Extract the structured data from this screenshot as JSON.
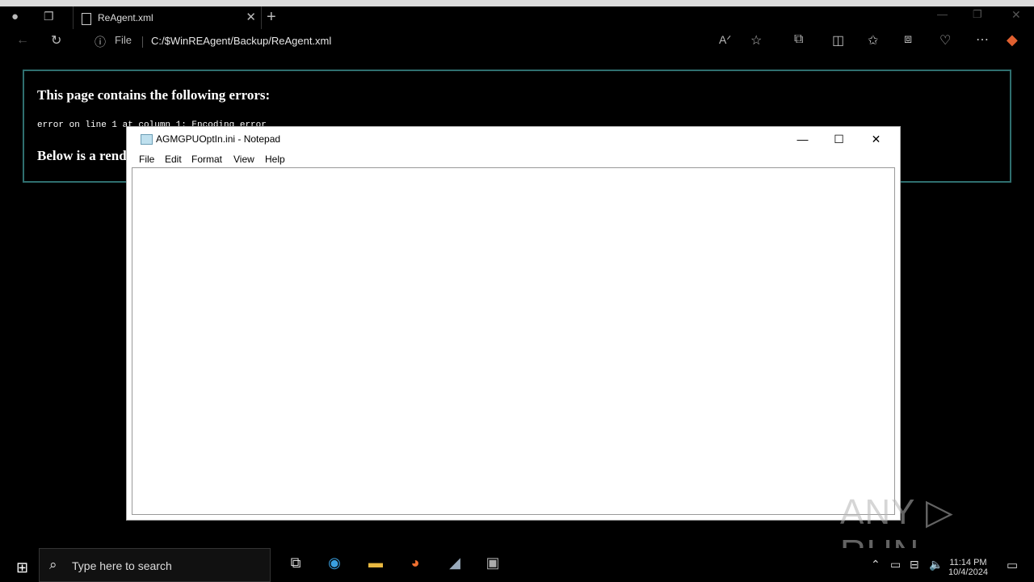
{
  "browser": {
    "tab_title": "ReAgent.xml",
    "address_prefix": "File",
    "url": "C:/$WinREAgent/Backup/ReAgent.xml"
  },
  "page": {
    "error_heading": "This page contains the following errors:",
    "error_line": "error on line 1 at column 1: Encoding error",
    "below_text": "Below is a rendering of the page up to the first error."
  },
  "notepad": {
    "title": "AGMGPUOptIn.ini - Notepad",
    "menu": [
      "File",
      "Edit",
      "Format",
      "View",
      "Help"
    ],
    "minimize_glyph": "—",
    "maximize_glyph": "☐",
    "close_glyph": "✕"
  },
  "taskbar": {
    "search_placeholder": "Type here to search",
    "time": "11:14 PM",
    "date": "10/4/2024"
  },
  "watermark": "ANY ▷ RUN"
}
